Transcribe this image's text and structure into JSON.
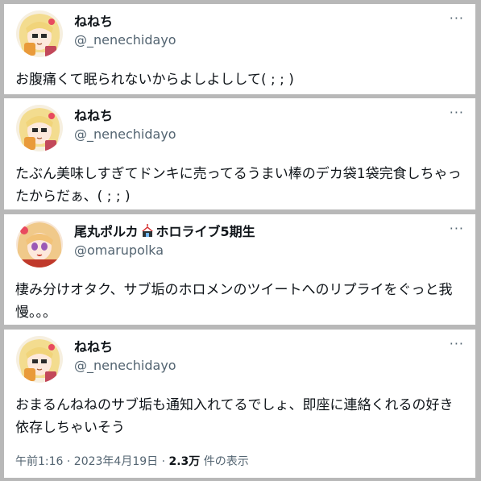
{
  "tweets": [
    {
      "name": "ねねち",
      "handle": "@_nenechidayo",
      "more": "···",
      "text": "お腹痛くて眠られないからよしよしして( ; ; )"
    },
    {
      "name": "ねねち",
      "handle": "@_nenechidayo",
      "more": "···",
      "text": "たぶん美味しすぎてドンキに売ってるうまい棒のデカ袋1袋完食しちゃったからだぁ、( ; ; )"
    },
    {
      "name_part1": "尾丸ポルカ",
      "name_part2": "ホロライブ5期生",
      "handle": "@omarupolka",
      "more": "···",
      "text": "棲み分けオタク、サブ垢のホロメンのツイートへのリプライをぐっと我慢。。。"
    },
    {
      "name": "ねねち",
      "handle": "@_nenechidayo",
      "more": "···",
      "text": "おまるんねねのサブ垢も通知入れてるでしょ、即座に連絡くれるの好き依存しちゃいそう",
      "timestamp": "午前1:16 · 2023年4月19日 · ",
      "views_count": "2.3万",
      "views_label": " 件の表示"
    }
  ],
  "icons": {
    "avatar_nene": "blonde-anime-avatar-icon",
    "avatar_polka": "polka-anime-avatar-icon",
    "circus_tent": "circus-tent-icon"
  },
  "colors": {
    "text_primary": "#0f1419",
    "text_secondary": "#536471",
    "separator": "#b8b8b8"
  }
}
